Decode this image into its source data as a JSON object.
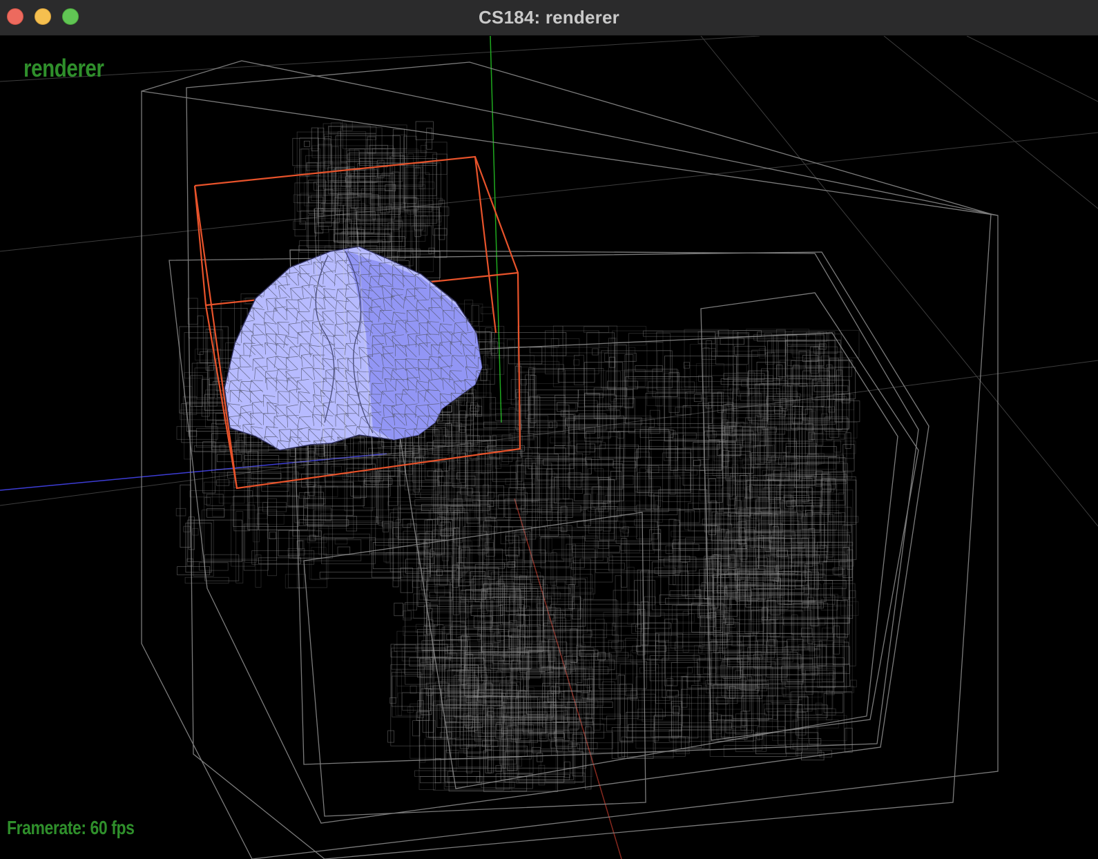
{
  "window": {
    "title": "CS184: renderer",
    "controls": [
      "close",
      "minimize",
      "zoom"
    ]
  },
  "overlay": {
    "app_name": "renderer",
    "framerate_text": "Framerate: 60 fps",
    "text_color": "#2f8f2b"
  },
  "scene": {
    "background_color": "#000000",
    "bvh_box_color": "#8f8f8f",
    "selected_node_color": "#e8532b",
    "mesh_fill_color": "#b7bbff",
    "mesh_shadow_color": "#8e92f4",
    "axis_colors": {
      "x": "#c0392b",
      "y": "#1faa1f",
      "z": "#4444ee"
    }
  }
}
